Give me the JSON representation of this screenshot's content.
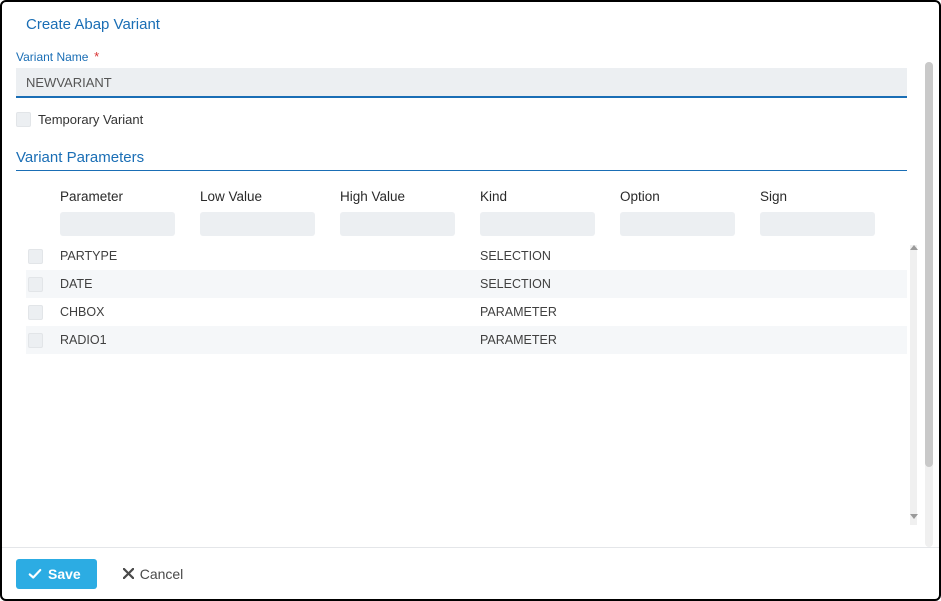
{
  "dialog": {
    "title": "Create Abap Variant"
  },
  "variant_name": {
    "label": "Variant Name",
    "value": "NEWVARIANT",
    "required_marker": "*"
  },
  "temporary": {
    "label": "Temporary Variant"
  },
  "section": {
    "title": "Variant Parameters"
  },
  "columns": {
    "parameter": "Parameter",
    "low": "Low Value",
    "high": "High Value",
    "kind": "Kind",
    "option": "Option",
    "sign": "Sign"
  },
  "rows": [
    {
      "parameter": "PARTYPE",
      "low": "",
      "high": "",
      "kind": "SELECTION",
      "option": "",
      "sign": ""
    },
    {
      "parameter": "DATE",
      "low": "",
      "high": "",
      "kind": "SELECTION",
      "option": "",
      "sign": ""
    },
    {
      "parameter": "CHBOX",
      "low": "",
      "high": "",
      "kind": "PARAMETER",
      "option": "",
      "sign": ""
    },
    {
      "parameter": "RADIO1",
      "low": "",
      "high": "",
      "kind": "PARAMETER",
      "option": "",
      "sign": ""
    }
  ],
  "footer": {
    "save": "Save",
    "cancel": "Cancel"
  }
}
